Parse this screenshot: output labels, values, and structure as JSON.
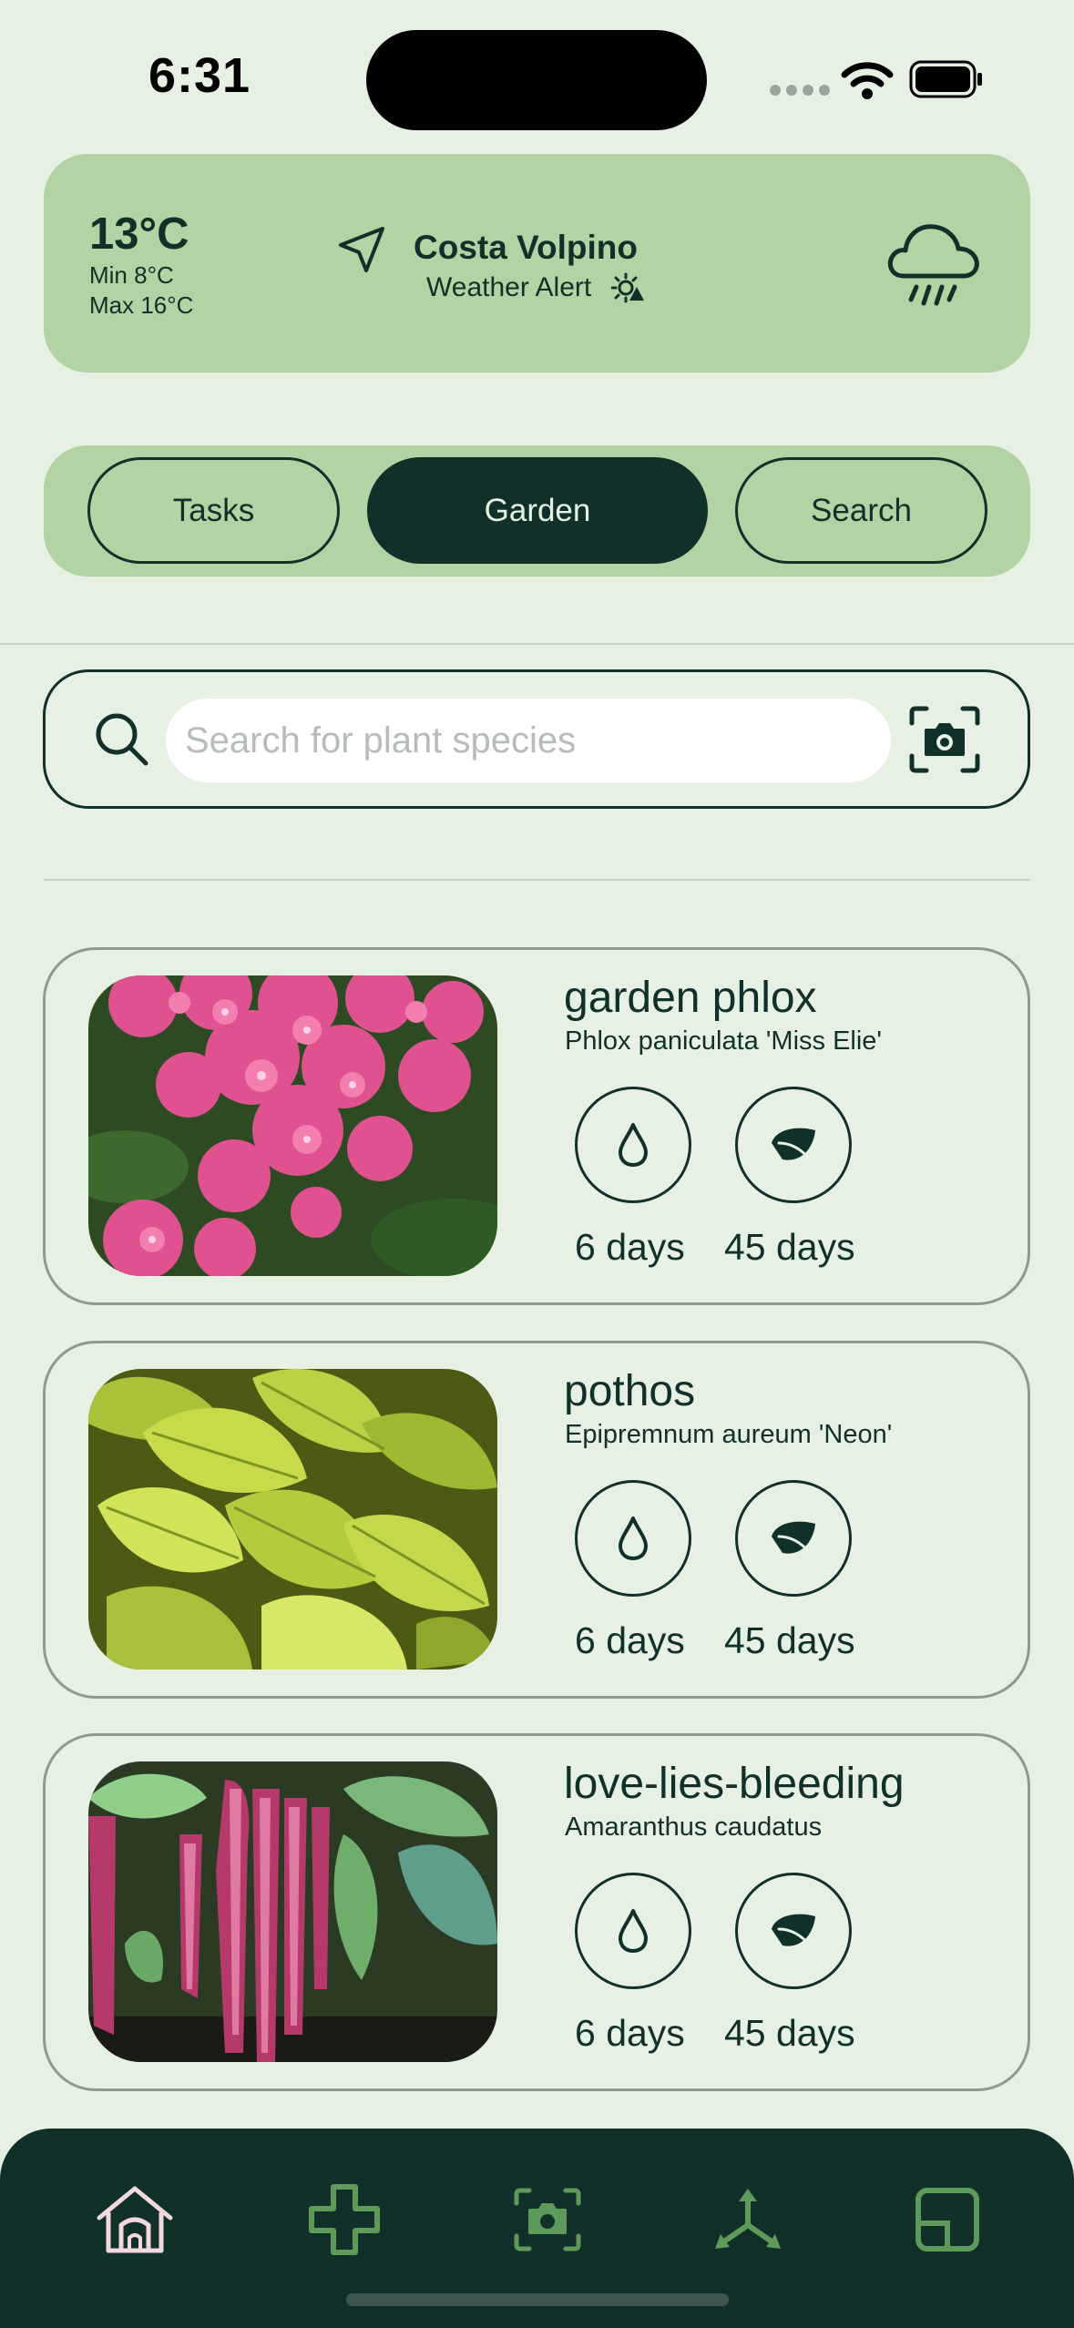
{
  "status_bar": {
    "time": "6:31"
  },
  "weather": {
    "temperature": "13°C",
    "min": "Min 8°C",
    "max": "Max 16°C",
    "location": "Costa Volpino",
    "alert": "Weather Alert",
    "condition_icon": "cloud-rain-icon"
  },
  "segments": [
    {
      "label": "Tasks",
      "active": false
    },
    {
      "label": "Garden",
      "active": true
    },
    {
      "label": "Search",
      "active": false
    }
  ],
  "search": {
    "placeholder": "Search for plant species",
    "value": ""
  },
  "plants": [
    {
      "name": "garden phlox",
      "scientific": "Phlox paniculata 'Miss Elie'",
      "water": "6 days",
      "fertilize": "45 days"
    },
    {
      "name": "pothos",
      "scientific": "Epipremnum aureum 'Neon'",
      "water": "6 days",
      "fertilize": "45 days"
    },
    {
      "name": "love-lies-bleeding",
      "scientific": "Amaranthus caudatus",
      "water": "6 days",
      "fertilize": "45 days"
    }
  ],
  "tabbar": {
    "items": [
      "home-icon",
      "add-icon",
      "camera-icon",
      "share-icon",
      "widget-icon"
    ],
    "active": "home-icon"
  },
  "colors": {
    "background": "#e6f1e4",
    "card_green": "#b3d3a4",
    "dark": "#11302a",
    "tab_inactive": "#5e9a5a",
    "tab_active": "#f3d8dd"
  }
}
